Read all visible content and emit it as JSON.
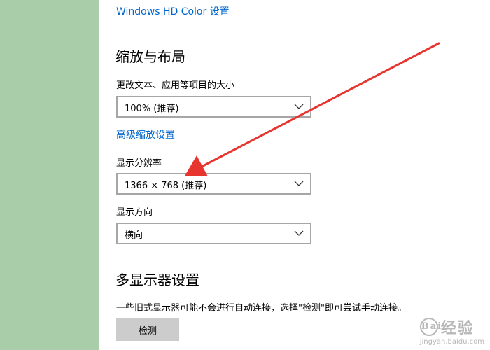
{
  "top_link": "Windows HD Color 设置",
  "scale_layout": {
    "title": "缩放与布局",
    "text_size_label": "更改文本、应用等项目的大小",
    "text_size_value": "100% (推荐)",
    "advanced_link": "高级缩放设置",
    "resolution_label": "显示分辨率",
    "resolution_value": "1366 × 768 (推荐)",
    "orientation_label": "显示方向",
    "orientation_value": "横向"
  },
  "multi_display": {
    "title": "多显示器设置",
    "description": "一些旧式显示器可能不会进行自动连接，选择\"检测\"即可尝试手动连接。",
    "detect_button": "检测"
  },
  "watermark": {
    "main": "经验",
    "sub": "jingyan.baidu.com"
  },
  "colors": {
    "link": "#0066cc",
    "left_panel": "#a8cda8",
    "arrow": "#e8342f",
    "button_bg": "#cccccc"
  }
}
